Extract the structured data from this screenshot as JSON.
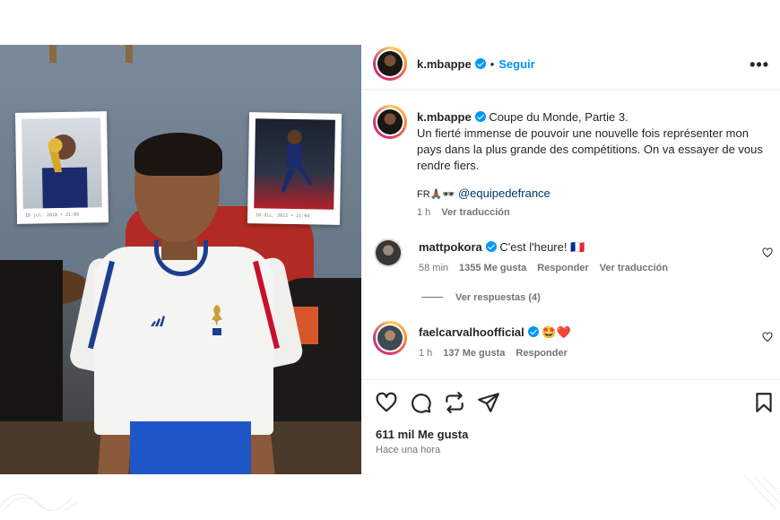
{
  "post": {
    "author": "k.mbappe",
    "follow_label": "Seguir",
    "separator": "•",
    "more_label": "•••"
  },
  "caption": {
    "author": "k.mbappe",
    "title": "Coupe du Monde, Partie 3.",
    "body": "Un fierté immense de pouvoir une nouvelle fois représenter mon pays dans la plus grande des compétitions. On va essayer de vous rendre fiers.",
    "emojis": "FR🙏🏾🕶",
    "mention": "@equipedefrance",
    "time": "1 h",
    "translate": "Ver traducción"
  },
  "comments": [
    {
      "author": "mattpokora",
      "text": "C'est l'heure! 🇫🇷",
      "time": "58 min",
      "likes": "1355 Me gusta",
      "reply": "Responder",
      "translate": "Ver traducción",
      "view_replies": "Ver respuestas (4)"
    },
    {
      "author": "faelcarvalhoofficial",
      "text": "🤩❤️",
      "time": "1 h",
      "likes": "137 Me gusta",
      "reply": "Responder"
    }
  ],
  "footer": {
    "likes": "611 mil Me gusta",
    "posted": "Hace una hora"
  },
  "photo": {
    "caption_left": "18 jul. 2018 • 21:09",
    "caption_right": "18 dic. 2022 • 21:04"
  },
  "icons": {
    "like": "heart-icon",
    "comment": "comment-icon",
    "share": "send-icon",
    "repost": "repost-icon",
    "save": "bookmark-icon",
    "more": "more-icon",
    "verified": "verified-badge-icon"
  },
  "colors": {
    "accent": "#0095f6",
    "text": "#262626",
    "muted": "#737373",
    "link": "#00376b"
  }
}
